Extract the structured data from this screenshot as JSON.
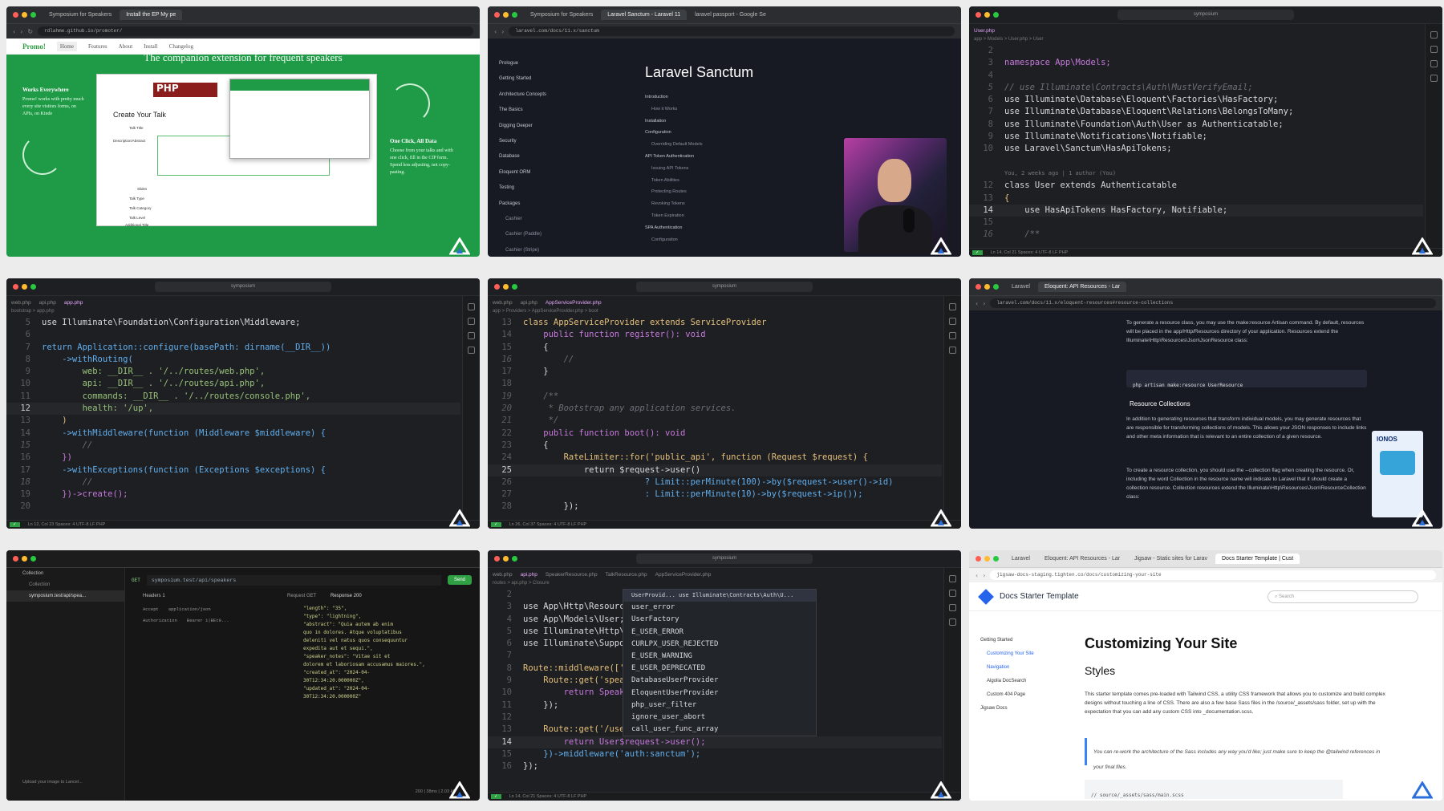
{
  "brand": {
    "logo_icon": "laracasts-logo-icon",
    "accent": "#2f9e44"
  },
  "t1": {
    "tabs": [
      "Symposium for Speakers",
      "Install the EP My pe"
    ],
    "url": "rdlahme.github.io/promoter/",
    "site_logo": "Promo!",
    "nav": [
      "Home",
      "Features",
      "About",
      "Install",
      "Changelog"
    ],
    "hero_title": "The companion extension for frequent speakers",
    "left_head": "Works Everywhere",
    "left_text": "Promo! works with pretty much every site visitors forms, on APIs, on Kinde",
    "form_title": "Create Your Talk",
    "form_labels": [
      "Talk Title",
      "Description/Abstract",
      "Slides",
      "Talk Type",
      "Talk Category",
      "Talk Level",
      "Additional Title"
    ],
    "right_head": "One Click, All Data",
    "right_text": "Choose from your talks and with one click, fill in the CfP form. Spend less adjusting, not copy-pasting."
  },
  "t2": {
    "tabs": [
      "Symposium for Speakers",
      "Laravel Sanctum - Laravel 11",
      "laravel passport - Google Se"
    ],
    "url": "laravel.com/docs/11.x/sanctum",
    "nav": [
      "Prologue",
      "Getting Started",
      "Architecture Concepts",
      "The Basics",
      "Digging Deeper",
      "Security",
      "Database",
      "Eloquent ORM",
      "Testing",
      "Packages",
      "Cashier",
      "Cashier (Paddle)",
      "Cashier (Stripe)"
    ],
    "title": "Laravel Sanctum",
    "toc": [
      "Introduction",
      "How it Works",
      "Installation",
      "Configuration",
      "Overriding Default Models",
      "API Token Authentication",
      "Issuing API Tokens",
      "Token Abilities",
      "Protecting Routes",
      "Revoking Tokens",
      "Token Expiration",
      "SPA Authentication",
      "Configuration",
      "Authenticating"
    ]
  },
  "t3": {
    "search": "symposium",
    "tab": "User.php",
    "crumb": "app > Models > User.php > User",
    "lines": [
      {
        "n": "2",
        "t": ""
      },
      {
        "n": "3",
        "t": "namespace App\\Models;"
      },
      {
        "n": "4",
        "t": ""
      },
      {
        "n": "5",
        "t": "// use Illuminate\\Contracts\\Auth\\MustVerifyEmail;"
      },
      {
        "n": "6",
        "t": "use Illuminate\\Database\\Eloquent\\Factories\\HasFactory;"
      },
      {
        "n": "7",
        "t": "use Illuminate\\Database\\Eloquent\\Relations\\BelongsToMany;"
      },
      {
        "n": "8",
        "t": "use Illuminate\\Foundation\\Auth\\User as Authenticatable;"
      },
      {
        "n": "9",
        "t": "use Illuminate\\Notifications\\Notifiable;"
      },
      {
        "n": "10",
        "t": "use Laravel\\Sanctum\\HasApiTokens;"
      },
      {
        "n": "",
        "t": ""
      },
      {
        "n": "",
        "t": "You, 2 weeks ago | 1 author (You)"
      },
      {
        "n": "12",
        "t": "class User extends Authenticatable"
      },
      {
        "n": "13",
        "t": "{"
      },
      {
        "n": "14",
        "t": "    use HasApiTokens HasFactory, Notifiable;"
      },
      {
        "n": "15",
        "t": ""
      },
      {
        "n": "16",
        "t": "    /**"
      }
    ],
    "status": "Ln 14, Col 21  Spaces: 4  UTF-8  LF  PHP"
  },
  "t4": {
    "search": "symposium",
    "tabs": [
      "web.php",
      "api.php",
      "app.php"
    ],
    "crumb": "bootstrap > app.php",
    "lines": [
      {
        "n": "5",
        "t": "use Illuminate\\Foundation\\Configuration\\Middleware;"
      },
      {
        "n": "6",
        "t": ""
      },
      {
        "n": "7",
        "t": "return Application::configure(basePath: dirname(__DIR__))"
      },
      {
        "n": "8",
        "t": "    ->withRouting("
      },
      {
        "n": "9",
        "t": "        web: __DIR__ . '/../routes/web.php',"
      },
      {
        "n": "10",
        "t": "        api: __DIR__ . '/../routes/api.php',"
      },
      {
        "n": "11",
        "t": "        commands: __DIR__ . '/../routes/console.php',"
      },
      {
        "n": "12",
        "t": "        health: '/up',"
      },
      {
        "n": "13",
        "t": "    )"
      },
      {
        "n": "14",
        "t": "    ->withMiddleware(function (Middleware $middleware) {"
      },
      {
        "n": "15",
        "t": "        //"
      },
      {
        "n": "16",
        "t": "    })"
      },
      {
        "n": "17",
        "t": "    ->withExceptions(function (Exceptions $exceptions) {"
      },
      {
        "n": "18",
        "t": "        //"
      },
      {
        "n": "19",
        "t": "    })->create();"
      },
      {
        "n": "20",
        "t": ""
      }
    ],
    "status": "Ln 12, Col 23  Spaces: 4  UTF-8  LF  PHP"
  },
  "t5": {
    "search": "symposium",
    "tabs": [
      "web.php",
      "api.php",
      "AppServiceProvider.php"
    ],
    "crumb": "app > Providers > AppServiceProvider.php > boot",
    "lines": [
      {
        "n": "13",
        "t": "class AppServiceProvider extends ServiceProvider"
      },
      {
        "n": "14",
        "t": "    public function register(): void"
      },
      {
        "n": "15",
        "t": "    {"
      },
      {
        "n": "16",
        "t": "        //"
      },
      {
        "n": "17",
        "t": "    }"
      },
      {
        "n": "18",
        "t": ""
      },
      {
        "n": "19",
        "t": "    /**"
      },
      {
        "n": "20",
        "t": "     * Bootstrap any application services."
      },
      {
        "n": "21",
        "t": "     */"
      },
      {
        "n": "22",
        "t": "    public function boot(): void"
      },
      {
        "n": "23",
        "t": "    {"
      },
      {
        "n": "24",
        "t": "        RateLimiter::for('public_api', function (Request $request) {"
      },
      {
        "n": "25",
        "t": "            return $request->user()"
      },
      {
        "n": "26",
        "t": "                        ? Limit::perMinute(100)->by($request->user()->id)"
      },
      {
        "n": "27",
        "t": "                        : Limit::perMinute(10)->by($request->ip());"
      },
      {
        "n": "28",
        "t": "        });"
      }
    ],
    "status": "Ln 26, Col 37  Spaces: 4  UTF-8  LF  PHP"
  },
  "t6": {
    "tabs": [
      "Laravel",
      "Eloquent: API Resources - Lar"
    ],
    "url": "laravel.com/docs/11.x/eloquent-resources#resource-collections",
    "p1": "To generate a resource class, you may use the make:resource Artisan command. By default, resources will be placed in the app/Http/Resources directory of your application. Resources extend the Illuminate\\Http\\Resources\\Json\\JsonResource class:",
    "cmd": "php artisan make:resource UserResource",
    "heading": "Resource Collections",
    "p2": "In addition to generating resources that transform individual models, you may generate resources that are responsible for transforming collections of models. This allows your JSON responses to include links and other meta information that is relevant to an entire collection of a given resource.",
    "p3": "To create a resource collection, you should use the --collection flag when creating the resource. Or, including the word Collection in the resource name will indicate to Laravel that it should create a collection resource. Collection resources extend the Illuminate\\Http\\Resources\\Json\\ResourceCollection class:",
    "ad": "IONOS"
  },
  "t7": {
    "url": "symposium.test/api/speakers",
    "method": "GET",
    "send": "Send",
    "side": [
      "Collection",
      "Collection",
      "symposium.test/api/spea..."
    ],
    "headers_label": "Headers 1",
    "header_rows": [
      [
        "Accept",
        "application/json"
      ],
      [
        "Authorization",
        "Bearer 1|BEt9..."
      ]
    ],
    "request_tab": "Request GET",
    "response_tab": "Response 200",
    "response": [
      "\"length\": \"35\",",
      "\"type\": \"lightning\",",
      "\"abstract\": \"Quia autem ab enim",
      "quo in dolores. Atque voluptatibus",
      "deleniti vel natus quos consequuntur",
      "expedita aut et sequi.\",",
      "\"speaker_notes\": \"Vitae sit et",
      "dolorem et laboriosam accusamus maiores.\",",
      "\"created_at\": \"2024-04-",
      "30T12:34:20.000000Z\",",
      "\"updated_at\": \"2024-04-",
      "30T12:34:20.000000Z\""
    ],
    "footer": "Upload your image to Lancel...",
    "status": "200 | 38ms | 2.03 kB"
  },
  "t8": {
    "search": "symposium",
    "tabs": [
      "web.php",
      "api.php",
      "SpeakerResource.php",
      "TalkResource.php",
      "AppServiceProvider.php"
    ],
    "crumb": "routes > api.php > Closure",
    "lines": [
      {
        "n": "2",
        "t": ""
      },
      {
        "n": "3",
        "t": "use App\\Http\\Resources\\UserProvid..."
      },
      {
        "n": "4",
        "t": "use App\\Models\\User;"
      },
      {
        "n": "5",
        "t": "use Illuminate\\Http\\"
      },
      {
        "n": "6",
        "t": "use Illuminate\\Suppo"
      },
      {
        "n": "7",
        "t": ""
      },
      {
        "n": "8",
        "t": "Route::middleware(['"
      },
      {
        "n": "9",
        "t": "    Route::get('speak"
      },
      {
        "n": "10",
        "t": "        return Speak"
      },
      {
        "n": "11",
        "t": "    });"
      },
      {
        "n": "12",
        "t": ""
      },
      {
        "n": "13",
        "t": "    Route::get('/use"
      },
      {
        "n": "14",
        "t": "        return User$request->user();"
      },
      {
        "n": "15",
        "t": "    })->middleware('auth:sanctum');"
      },
      {
        "n": "16",
        "t": "});"
      }
    ],
    "suggest": [
      "UserProvid... use Illuminate\\Contracts\\Auth\\U...",
      "user_error",
      "UserFactory",
      "E_USER_ERROR",
      "CURLPX_USER_REJECTED",
      "E_USER_WARNING",
      "E_USER_DEPRECATED",
      "DatabaseUserProvider",
      "EloquentUserProvider",
      "php_user_filter",
      "ignore_user_abort",
      "call_user_func_array"
    ],
    "status": "Ln 14, Col 21  Spaces: 4  UTF-8  LF  PHP"
  },
  "t9": {
    "tabs": [
      "Laravel",
      "Eloquent: API Resources - Lar",
      "Jigsaw - Static sites for Larav",
      "Docs Starter Template | Cust"
    ],
    "url": "jigsaw-docs-staging.tighten.co/docs/customizing-your-site",
    "brand": "Docs Starter Template",
    "search_ph": "Search",
    "nav": [
      "Getting Started",
      "Customizing Your Site",
      "Navigation",
      "Algolia DocSearch",
      "Custom 404 Page",
      "Jigsaw Docs"
    ],
    "h1": "Customizing Your Site",
    "h2": "Styles",
    "p": "This starter template comes pre-loaded with Tailwind CSS, a utility CSS framework that allows you to customize and build complex designs without touching a line of CSS. There are also a few base Sass files in the /source/_assets/sass folder, set up with the expectation that you can add any custom CSS into _documentation.scss.",
    "quote": "You can re-work the architecture of the Sass includes any way you'd like; just make sure to keep the @tailwind references in your final files.",
    "code": "// source/_assets/sass/main.scss"
  }
}
